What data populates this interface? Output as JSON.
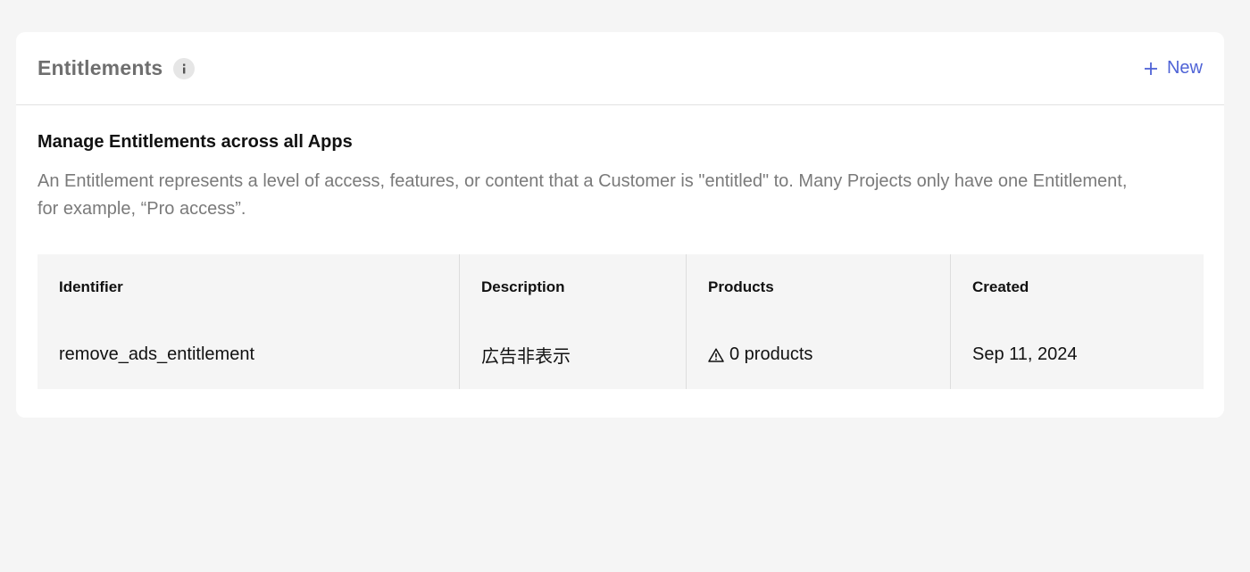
{
  "header": {
    "title": "Entitlements",
    "new_label": "New"
  },
  "section": {
    "title": "Manage Entitlements across all Apps",
    "description": "An Entitlement represents a level of access, features, or content that a Customer is \"entitled\" to. Many Projects only have one Entitlement, for example, “Pro access”."
  },
  "table": {
    "columns": [
      "Identifier",
      "Description",
      "Products",
      "Created"
    ],
    "rows": [
      {
        "identifier": "remove_ads_entitlement",
        "description": "広告非表示",
        "products": "0 products",
        "created": "Sep 11, 2024"
      }
    ]
  },
  "icons": {
    "info": "info-icon",
    "plus": "plus-icon",
    "warning": "warning-icon"
  },
  "colors": {
    "accent": "#4f63d6",
    "background": "#f5f5f5",
    "card": "#ffffff",
    "muted_text": "#7a7a7a"
  }
}
